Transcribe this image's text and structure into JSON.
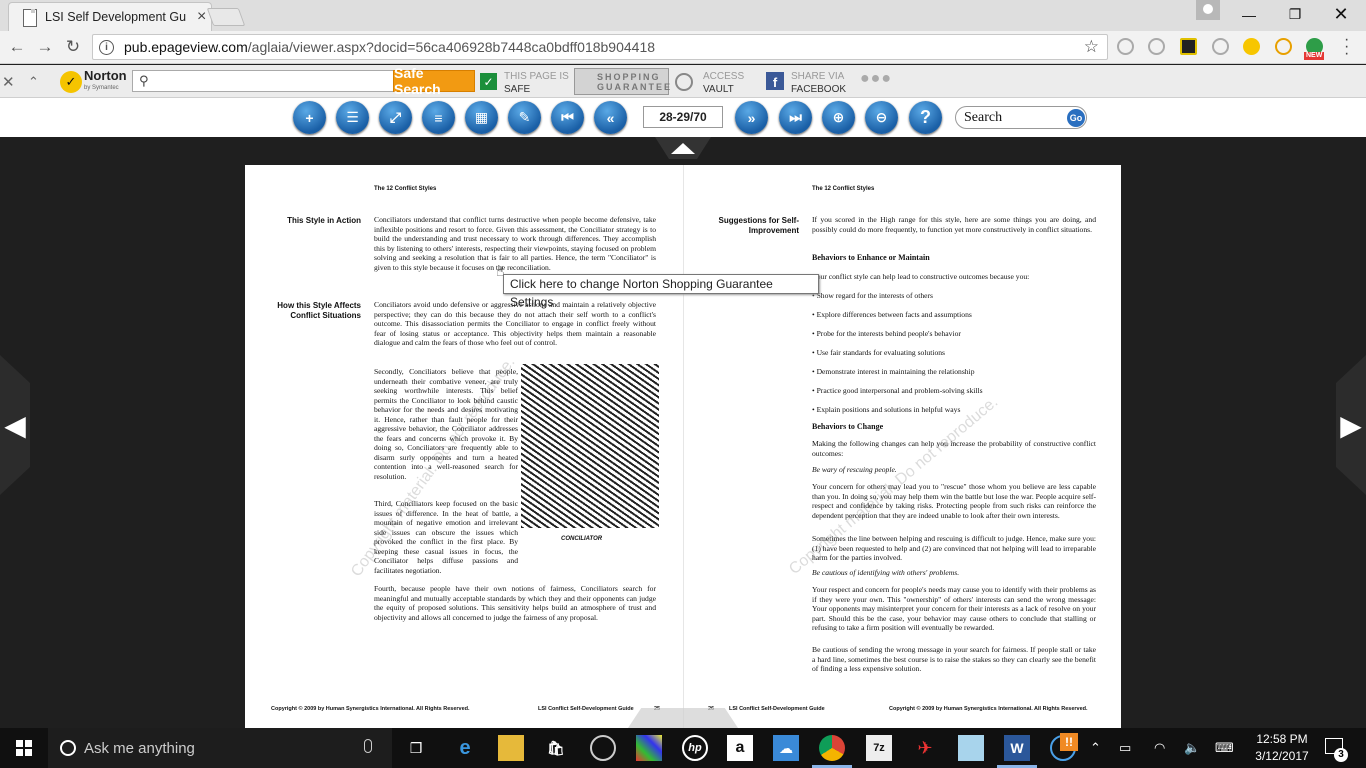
{
  "browser": {
    "tab_title": "LSI Self Development Gu",
    "tab_close": "×",
    "url_domain": "pub.epageview.com",
    "url_path": "/aglaia/viewer.aspx?docid=56ca406928b7448ca0bdff018b904418"
  },
  "norton": {
    "brand": "Norton",
    "brand_sub": "by Symantec",
    "search_button": "Safe Search",
    "page_safe_line1": "THIS PAGE IS",
    "page_safe_line2": "SAFE",
    "guarantee_line1": "SHOPPING",
    "guarantee_line2": "GUARANTEE",
    "vault_line1": "ACCESS",
    "vault_line2": "VAULT",
    "facebook_line1": "SHARE VIA",
    "facebook_line2": "FACEBOOK",
    "tooltip": "Click here to change Norton Shopping Guarantee Settings"
  },
  "viewer": {
    "page_indicator": "28-29/70",
    "search_label": "Search",
    "go_label": "Go"
  },
  "left_page": {
    "header": "The 12 Conflict Styles",
    "label1": "This Style in Action",
    "para1": "Conciliators understand that conflict turns destructive when people become defensive, take inflexible positions and resort to force. Given this assessment, the Conciliator strategy is to build the understanding and trust necessary to work through differences. They accomplish this by listening to others' interests, respecting their viewpoints, staying focused on problem solving and seeking a resolution that is fair to all parties. Hence, the term \"Conciliator\" is given to this style because it focuses on the reconciliation.",
    "label2a": "How this Style Affects",
    "label2b": "Conflict Situations",
    "para2": "Conciliators avoid undo defensive or aggressive actions and maintain a relatively objective perspective; they can do this because they do not attach their self worth to a conflict's outcome. This disassociation permits the Conciliator to engage in conflict freely without fear of losing status or acceptance. This objectivity helps them maintain a reasonable dialogue and calm the fears of those who feel out of control.",
    "para3": "Secondly, Conciliators believe that people, underneath their combative veneer, are truly seeking worthwhile interests. This belief permits the Conciliator to look behind caustic behavior for the needs and desires motivating it. Hence, rather than fault people for their aggressive behavior, the Conciliator addresses the fears and concerns which provoke it. By doing so, Conciliators are frequently able to disarm surly opponents and turn a heated contention into a well-reasoned search for resolution.",
    "para4": "Third, Conciliators keep focused on the basic issues of difference. In the heat of battle, a mountain of negative emotion and irrelevant side issues can obscure the issues which provoked the conflict in the first place. By keeping these casual issues in focus, the Conciliator helps diffuse passions and facilitates negotiation.",
    "para5": "Fourth, because people have their own notions of fairness, Conciliators search for meaningful and mutually acceptable standards by which they and their opponents can judge the equity of proposed solutions. This sensitivity helps build an atmosphere of trust and objectivity and allows all concerned to judge the fairness of any proposal.",
    "illustration_caption": "CONCILIATOR",
    "footer_left": "Copyright © 2009 by Human Synergistics International. All Rights Reserved.",
    "footer_right": "LSI Conflict Self-Development Guide",
    "page_number": "25",
    "watermark": "Copyright material. Do not reproduce."
  },
  "right_page": {
    "header": "The 12 Conflict Styles",
    "label1a": "Suggestions for Self-",
    "label1b": "Improvement",
    "intro": "If you scored in the High range for this style, here are some things you are doing, and possibly could do more frequently, to function yet more constructively in conflict situations.",
    "heading1": "Behaviors to Enhance or Maintain",
    "lead1": "Your conflict style can help lead to constructive outcomes because you:",
    "bullets": [
      "Show regard for the interests of others",
      "Explore differences between facts and assumptions",
      "Probe for the interests behind people's behavior",
      "Use fair standards for evaluating solutions",
      "Demonstrate interest in maintaining the relationship",
      "Practice good interpersonal and problem-solving skills",
      "Explain positions and solutions in helpful ways"
    ],
    "heading2": "Behaviors to Change",
    "lead2": "Making the following changes can help you increase the probability of constructive conflict outcomes:",
    "sub1": "Be wary of rescuing people.",
    "body1": "Your concern for others may lead you to \"rescue\" those whom you believe are less capable than you. In doing so, you may help them win the battle but lose the war. People acquire self-respect and confidence by taking risks. Protecting people from such risks can reinforce the dependent perception that they are indeed unable to look after their own interests.",
    "body2": "Sometimes the line between helping and rescuing is difficult to judge. Hence, make sure you: (1) have been requested to help and (2) are convinced that not helping will lead to irreparable harm for the parties involved.",
    "sub2": "Be cautious of identifying with others' problems.",
    "body3": "Your respect and concern for people's needs may cause you to identify with their problems as if they were your own. This \"ownership\" of others' interests can send the wrong message: Your opponents may misinterpret your concern for their interests as a lack of resolve on your part. Should this be the case, your behavior may cause others to conclude that stalling or refusing to take a firm position will eventually be rewarded.",
    "body4": "Be cautious of sending the wrong message in your search for fairness. If people stall or take a hard line, sometimes the best course is to raise the stakes so they can clearly see the benefit of finding a less expensive solution.",
    "page_number": "26",
    "footer_left": "LSI Conflict Self-Development Guide",
    "footer_right": "Copyright © 2009 by Human Synergistics International. All Rights Reserved.",
    "watermark": "Copyright material. Do not reproduce."
  },
  "taskbar": {
    "search_placeholder": "Ask me anything",
    "time": "12:58 PM",
    "date": "3/12/2017",
    "notification_count": "3",
    "notice_badge": "NEW"
  },
  "colors": {
    "safe_search": "#f29a12",
    "viewer_blue": "#1a5fa6",
    "taskbar": "#101010"
  }
}
